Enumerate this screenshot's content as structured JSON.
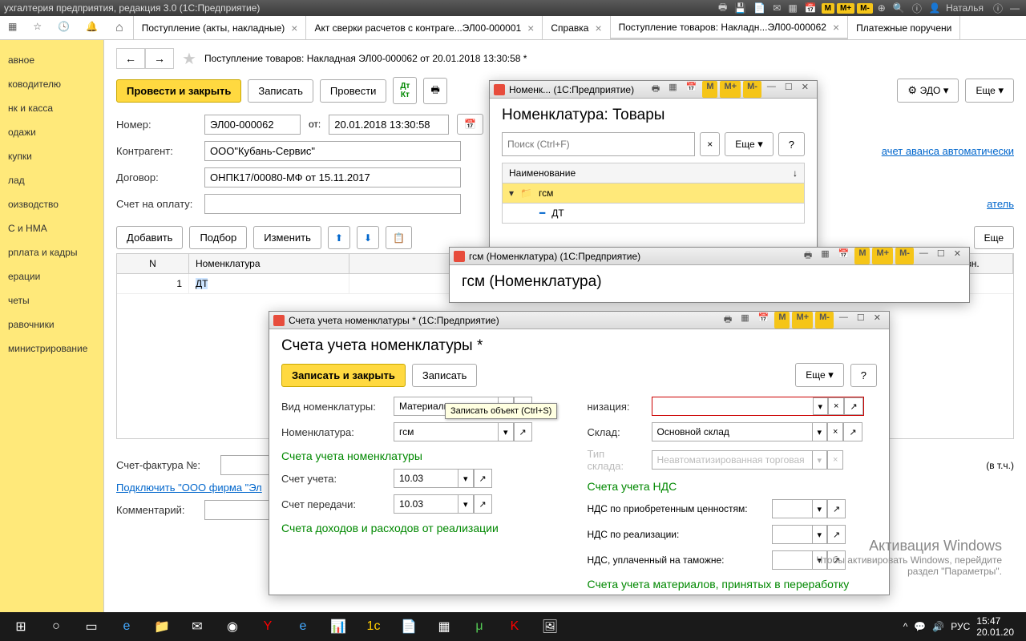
{
  "app": {
    "title": "ухгалтерия предприятия, редакция 3.0  (1С:Предприятие)",
    "user": "Наталья"
  },
  "tabs": {
    "t1": "Поступление (акты, накладные)",
    "t2": "Акт сверки расчетов с контраге...ЭЛ00-000001",
    "t3": "Справка",
    "t4": "Поступление товаров: Накладн...ЭЛ00-000062",
    "t5": "Платежные поручени"
  },
  "sidebar": {
    "items": [
      "авное",
      "ководителю",
      "нк и касса",
      "одажи",
      "купки",
      "лад",
      "оизводство",
      "С и НМА",
      "рплата и кадры",
      "ерации",
      "четы",
      "равочники",
      "министрирование"
    ]
  },
  "doc": {
    "title": "Поступление товаров: Накладная ЭЛ00-000062 от 20.01.2018 13:30:58 *",
    "btn_save_close": "Провести и закрыть",
    "btn_save": "Записать",
    "btn_post": "Провести",
    "btn_edo": "ЭДО",
    "btn_more": "Еще",
    "label_num": "Номер:",
    "num": "ЭЛ00-000062",
    "label_from": "от:",
    "date": "20.01.2018 13:30:58",
    "label_contractor": "Контрагент:",
    "contractor": "ООО\"Кубань-Сервис\"",
    "label_agreement": "Договор:",
    "agreement": "ОНПК17/00080-МФ от 15.11.2017",
    "label_invoice": "Счет на оплату:",
    "link_advance": "ачет аванса автоматически",
    "link_sender": "атель",
    "tb_add": "Добавить",
    "tb_select": "Подбор",
    "tb_edit": "Изменить",
    "col_n": "N",
    "col_nom": "Номенклатура",
    "col_sum": "Сумма розн.",
    "row1_n": "1",
    "row1_nom": "ДТ",
    "label_sf": "Счет-фактура №:",
    "link_firm": "Подключить \"ООО фирма \"Эл",
    "label_comment": "Комментарий:",
    "vat_note": "(в т.ч.)"
  },
  "popup_nom": {
    "wintitle": "Номенк...  (1С:Предприятие)",
    "heading": "Номенклатура: Товары",
    "search_ph": "Поиск (Ctrl+F)",
    "btn_more": "Еще",
    "col_name": "Наименование",
    "item_gsm": "гсм",
    "item_dt": "ДТ"
  },
  "popup_gsm": {
    "wintitle": "гсм (Номенклатура)  (1С:Предприятие)",
    "heading": "гсм (Номенклатура)"
  },
  "popup_acc": {
    "wintitle": "Счета учета номенклатуры *  (1С:Предприятие)",
    "heading": "Счета учета номенклатуры *",
    "btn_save_close": "Записать и закрыть",
    "btn_save": "Записать",
    "btn_more": "Еще",
    "tooltip": "Записать объект (Ctrl+S)",
    "label_vid": "Вид номенклатуры:",
    "vid": "Материалы",
    "label_org": "низация:",
    "label_nom": "Номенклатура:",
    "nom": "гсм",
    "label_warehouse": "Склад:",
    "warehouse": "Основной склад",
    "label_whtype": "Тип склада:",
    "whtype": "Неавтоматизированная торговая точка",
    "section1": "Счета учета номенклатуры",
    "section2": "Счета учета НДС",
    "label_acc": "Счет учета:",
    "acc": "10.03",
    "label_transfer": "Счет передачи:",
    "transfer": "10.03",
    "label_nds1": "НДС по приобретенным ценностям:",
    "label_nds2": "НДС по реализации:",
    "label_nds3": "НДС, уплаченный на таможне:",
    "section3": "Счета доходов и расходов от реализации",
    "section4": "Счета учета материалов, принятых в переработку"
  },
  "watermark": {
    "l1": "Активация Windows",
    "l2": "Чтобы активировать Windows, перейдите",
    "l3": "раздел \"Параметры\"."
  },
  "tray": {
    "lang": "РУС",
    "time": "15:47",
    "date": "20.01.20"
  }
}
